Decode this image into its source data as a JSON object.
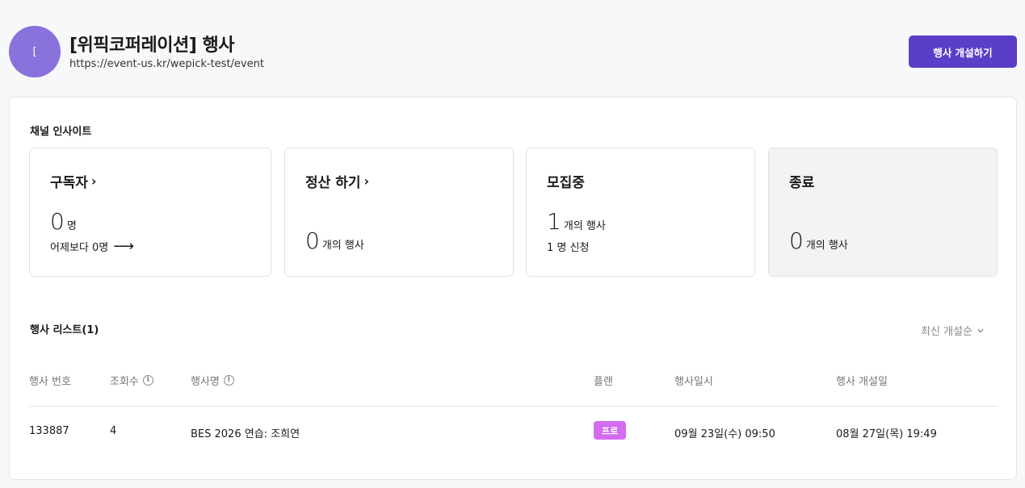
{
  "header": {
    "avatar_text": "[",
    "title": "[위픽코퍼레이션] 행사",
    "url": "https://event-us.kr/wepick-test/event",
    "create_button": "행사 개설하기"
  },
  "insight": {
    "title": "채널 인사이트",
    "cards": [
      {
        "title": "구독자",
        "value": "0",
        "unit": "명",
        "sub": "어제보다 0명"
      },
      {
        "title": "정산 하기",
        "value": "0",
        "unit": "개의 행사"
      },
      {
        "title": "모집중",
        "value": "1",
        "unit": "개의 행사",
        "sub": "1 명 신청"
      },
      {
        "title": "종료",
        "value": "0",
        "unit": "개의 행사"
      }
    ]
  },
  "list": {
    "title": "행사 리스트(1)",
    "sort_label": "최신 개설순",
    "columns": [
      "행사 번호",
      "조회수",
      "행사명",
      "플랜",
      "행사일시",
      "행사 개설일"
    ],
    "rows": [
      {
        "id": "133887",
        "views": "4",
        "name": "BES 2026 연습: 조희연",
        "plan": "프로",
        "event_date": "09월 23일(수) 09:50",
        "created": "08월 27일(목) 19:49"
      }
    ]
  },
  "colors": {
    "accent": "#5b3ec8",
    "avatar": "#8a72dd",
    "plan_badge": "#d36cf0"
  },
  "icons": [
    "chevron-right-icon",
    "arrow-right-icon",
    "info-icon",
    "chevron-down-icon"
  ]
}
